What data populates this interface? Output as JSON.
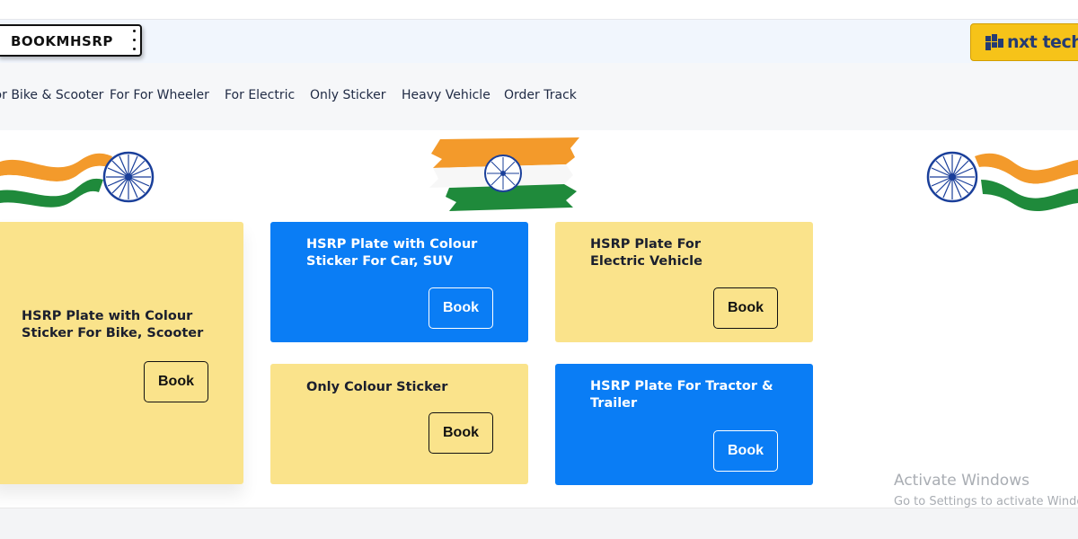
{
  "header": {
    "logo_text": "BOOKMHSRP",
    "partner_logo_text": "nxt tech"
  },
  "nav": {
    "items": [
      {
        "label": "For Bike & Scooter"
      },
      {
        "label": "For For Wheeler"
      },
      {
        "label": "For Electric"
      },
      {
        "label": "Only Sticker"
      },
      {
        "label": "Heavy Vehicle"
      },
      {
        "label": "Order Track"
      }
    ]
  },
  "cards": [
    {
      "title_line1": "HSRP Plate with Colour",
      "title_line2": "Sticker For Bike, Scooter",
      "button": "Book",
      "color": "#fae38b"
    },
    {
      "title_line1": "HSRP Plate with Colour",
      "title_line2": "Sticker For Car, SUV",
      "button": "Book",
      "color": "#0a7df5"
    },
    {
      "title_line1": "HSRP Plate For",
      "title_line2": "Electric Vehicle",
      "button": "Book",
      "color": "#fae38b"
    },
    {
      "title_line1": "Only Colour Sticker",
      "title_line2": "",
      "button": "Book",
      "color": "#fae38b"
    },
    {
      "title_line1": "HSRP Plate For Tractor &",
      "title_line2": "Trailer",
      "button": "Book",
      "color": "#0a7df5"
    }
  ],
  "watermark": {
    "line1": "Activate Windows",
    "line2": "Go to Settings to activate Windows."
  },
  "colors": {
    "yellow_card": "#fae38b",
    "blue_card": "#0a7df5",
    "saffron": "#f39a2b",
    "green": "#1f8a3b",
    "chakra": "#1a3f9a"
  }
}
